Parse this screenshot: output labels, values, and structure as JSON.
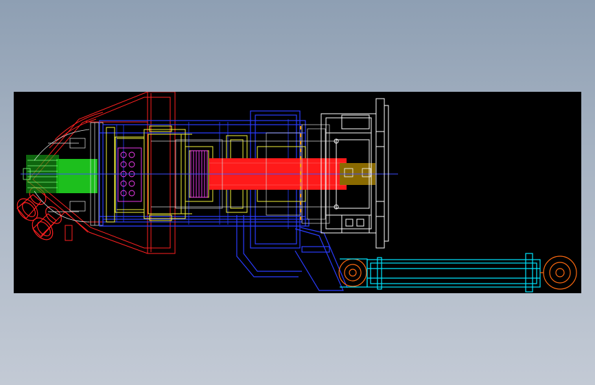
{
  "viewport": {
    "background": "#000000",
    "layer_colors": {
      "housing": "#ff2020",
      "frame": "#2a3cff",
      "drive": "#f5f53a",
      "bearing": "#ff40ff",
      "shaft": "#ff1a1a",
      "motor": "#ffffff",
      "coupling_block": "#8a6a00",
      "cylinder": "#00e5ff",
      "cylinder_end": "#ff6a10",
      "green_part": "#22e022",
      "orange_bolts": "#ff9a00"
    }
  }
}
